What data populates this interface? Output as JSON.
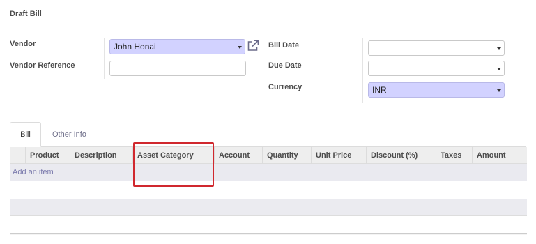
{
  "page": {
    "title": "Draft Bill"
  },
  "form": {
    "vendor_label": "Vendor",
    "vendor_value": "John Honai",
    "vendor_ref_label": "Vendor Reference",
    "vendor_ref_value": "",
    "bill_date_label": "Bill Date",
    "bill_date_value": "",
    "due_date_label": "Due Date",
    "due_date_value": "",
    "currency_label": "Currency",
    "currency_value": "INR"
  },
  "tabs": {
    "bill": "Bill",
    "other_info": "Other Info"
  },
  "table": {
    "columns": [
      "Product",
      "Description",
      "Asset Category",
      "Account",
      "Quantity",
      "Unit Price",
      "Discount (%)",
      "Taxes",
      "Amount"
    ],
    "add_item": "Add an item"
  },
  "colors": {
    "required_field_bg": "#d2d2ff",
    "link": "#7c7bad",
    "highlight": "#d0282e"
  },
  "icons": {
    "external_link": "external-link-icon",
    "dropdown": "caret-down-icon"
  }
}
